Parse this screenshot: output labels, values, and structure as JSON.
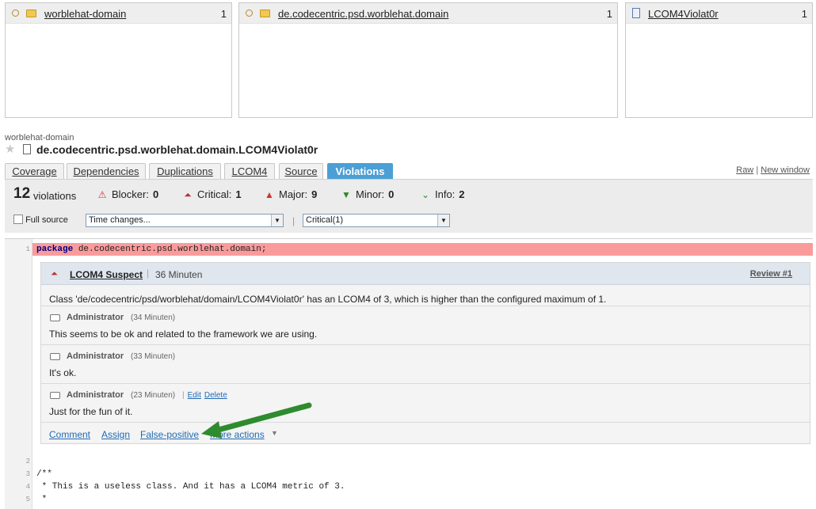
{
  "panels": [
    {
      "name": "worblehat-domain",
      "count": "1"
    },
    {
      "name": "de.codecentric.psd.worblehat.domain",
      "count": "1"
    },
    {
      "name": "LCOM4Violat0r",
      "count": "1"
    }
  ],
  "breadcrumb": "worblehat-domain",
  "file_title": "de.codecentric.psd.worblehat.domain.LCOM4Violat0r",
  "tabs": [
    "Coverage",
    "Dependencies",
    "Duplications",
    "LCOM4",
    "Source",
    "Violations"
  ],
  "active_tab": "Violations",
  "view_links": {
    "raw": "Raw",
    "new_window": "New window"
  },
  "violations": {
    "total": "12",
    "total_label": "violations",
    "blocker": {
      "label": "Blocker:",
      "value": "0"
    },
    "critical": {
      "label": "Critical:",
      "value": "1"
    },
    "major": {
      "label": "Major:",
      "value": "9"
    },
    "minor": {
      "label": "Minor:",
      "value": "0"
    },
    "info": {
      "label": "Info:",
      "value": "2"
    }
  },
  "filters": {
    "full_source_label": "Full source",
    "time_changes": "Time changes...",
    "severity": "Critical(1)"
  },
  "code": {
    "line1_keyword": "package",
    "line1_rest": " de.codecentric.psd.worblehat.domain;",
    "line3": "/**",
    "line4": " * This is a useless class. And it has a LCOM4 metric of 3.",
    "line5": " *"
  },
  "review": {
    "title": "LCOM4 Suspect",
    "time": "36 Minuten",
    "number": "Review #1",
    "description": "Class 'de/codecentric/psd/worblehat/domain/LCOM4Violat0r' has an LCOM4 of 3, which is higher than the configured maximum of 1.",
    "comments": [
      {
        "author": "Administrator",
        "time": "(34 Minuten)",
        "text": "This seems to be ok and related to the framework we are using."
      },
      {
        "author": "Administrator",
        "time": "(33 Minuten)",
        "text": "It's ok."
      },
      {
        "author": "Administrator",
        "time": "(23 Minuten)",
        "text": "Just for the fun of it.",
        "edit": "Edit",
        "delete": "Delete"
      }
    ],
    "actions": {
      "comment": "Comment",
      "assign": "Assign",
      "false_positive": "False-positive",
      "more": "More actions"
    }
  },
  "colors": {
    "active_tab": "#4b9fd5",
    "violation_line": "#fa9b9b",
    "arrow": "#2e8b2e"
  }
}
